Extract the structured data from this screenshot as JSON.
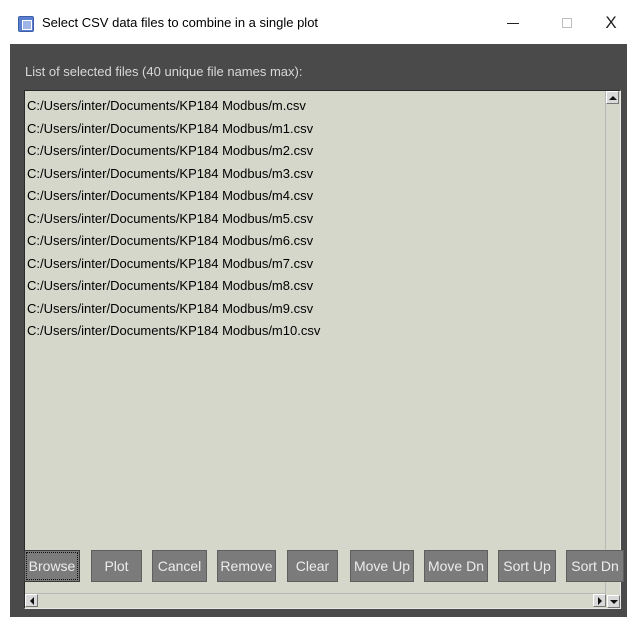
{
  "window": {
    "title": "Select CSV data files to combine in a single plot",
    "icon": "app-icon",
    "controls": {
      "minimize_icon": "minimize-icon",
      "maximize_icon": "maximize-icon",
      "close_label": "X"
    }
  },
  "file_list": {
    "caption": "List of selected files (40 unique file names max):",
    "items": [
      "C:/Users/inter/Documents/KP184 Modbus/m.csv",
      "C:/Users/inter/Documents/KP184 Modbus/m1.csv",
      "C:/Users/inter/Documents/KP184 Modbus/m2.csv",
      "C:/Users/inter/Documents/KP184 Modbus/m3.csv",
      "C:/Users/inter/Documents/KP184 Modbus/m4.csv",
      "C:/Users/inter/Documents/KP184 Modbus/m5.csv",
      "C:/Users/inter/Documents/KP184 Modbus/m6.csv",
      "C:/Users/inter/Documents/KP184 Modbus/m7.csv",
      "C:/Users/inter/Documents/KP184 Modbus/m8.csv",
      "C:/Users/inter/Documents/KP184 Modbus/m9.csv",
      "C:/Users/inter/Documents/KP184 Modbus/m10.csv"
    ]
  },
  "buttons": {
    "browse": "Browse",
    "plot": "Plot",
    "cancel": "Cancel",
    "remove": "Remove",
    "clear": "Clear",
    "move_up": "Move Up",
    "move_dn": "Move Dn",
    "sort_up": "Sort Up",
    "sort_dn": "Sort Dn"
  },
  "colors": {
    "client_background": "#4a4a4a",
    "listbox_background": "#d5d7cb",
    "button_background": "#7b7b7b",
    "button_text": "#ececec"
  }
}
